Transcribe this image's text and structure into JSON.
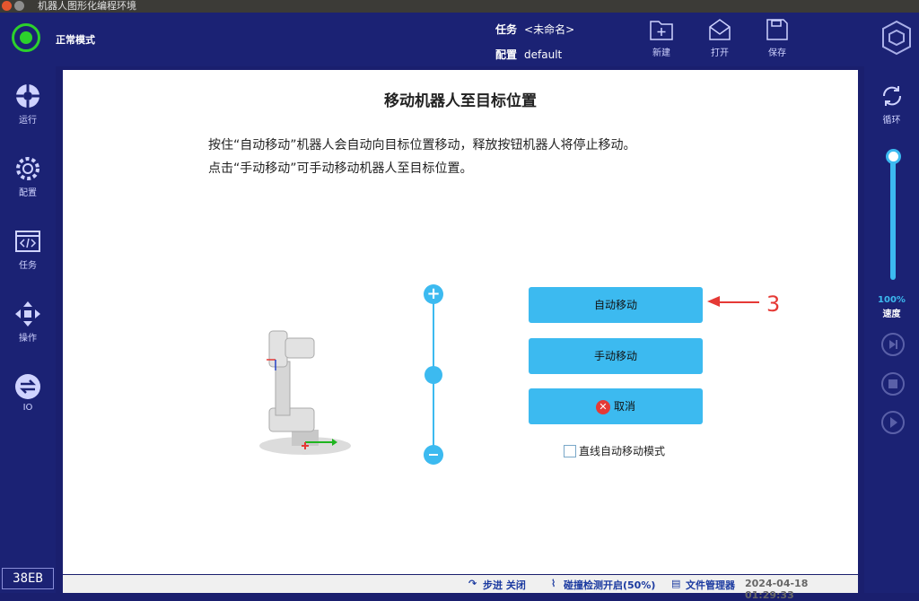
{
  "window": {
    "title": "机器人图形化编程环境"
  },
  "header": {
    "mode": "正常模式",
    "task_label": "任务",
    "task_value": "<未命名>",
    "config_label": "配置",
    "config_value": "default",
    "new_label": "新建",
    "open_label": "打开",
    "save_label": "保存"
  },
  "sidebar": {
    "items": [
      {
        "label": "运行",
        "icon": "run-icon"
      },
      {
        "label": "配置",
        "icon": "config-icon"
      },
      {
        "label": "任务",
        "icon": "task-icon"
      },
      {
        "label": "操作",
        "icon": "move-icon"
      },
      {
        "label": "IO",
        "icon": "io-icon"
      }
    ],
    "version": "38EB"
  },
  "rightbar": {
    "loop_label": "循环",
    "speed_percent": "100%",
    "speed_label": "速度",
    "speed_value": 1.0
  },
  "main": {
    "title": "移动机器人至目标位置",
    "desc_line1": "按住“自动移动”机器人会自动向目标位置移动，释放按钮机器人将停止移动。",
    "desc_line2": "点击“手动移动”可手动移动机器人至目标位置。",
    "auto_move": "自动移动",
    "manual_move": "手动移动",
    "cancel": "取消",
    "linear_mode": "直线自动移动模式",
    "annotation": "3"
  },
  "statusbar": {
    "step": "步进 关闭",
    "collision": "碰撞检测开启(50%)",
    "file_manager": "文件管理器",
    "datetime": "2024-04-18 01:29:33"
  },
  "colors": {
    "accent": "#3cbaf0",
    "bar": "#1b2274",
    "status_ok": "#2cd12c",
    "annotation": "#e53935"
  }
}
